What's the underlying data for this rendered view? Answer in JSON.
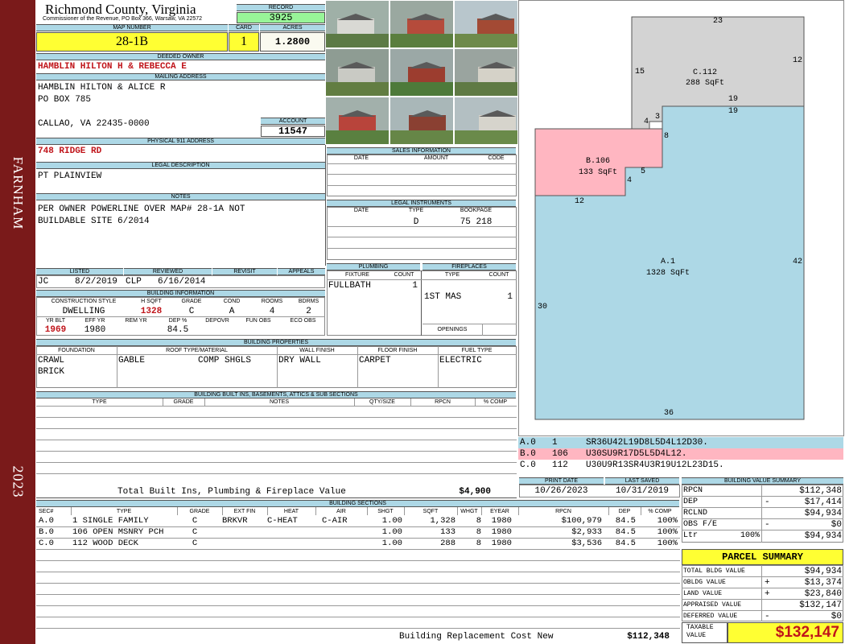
{
  "sidebar": {
    "district": "FARNHAM",
    "year": "2023"
  },
  "header": {
    "county": "Richmond County, Virginia",
    "commissioner": "Commissioner of the Revenue, PO Box 366, Warsaw, VA 22572",
    "record_label": "RECORD",
    "record": "3925",
    "map_number_label": "MAP NUMBER",
    "map_number": "28-1B",
    "card_label": "CARD",
    "card": "1",
    "acres_label": "ACRES",
    "acres": "1.2800"
  },
  "owner": {
    "deeded_owner_label": "DEEDED OWNER",
    "deeded_owner": "HAMBLIN HILTON H & REBECCA E",
    "mailing_label": "MAILING ADDRESS",
    "mailing_line1": "HAMBLIN HILTON & ALICE R",
    "mailing_line2": "PO BOX 785",
    "mailing_line3": "CALLAO, VA 22435-0000",
    "account_label": "ACCOUNT",
    "account": "11547",
    "physical_label": "PHYSICAL 911 ADDRESS",
    "physical": "748 RIDGE RD",
    "legal_label": "LEGAL DESCRIPTION",
    "legal": "PT PLAINVIEW",
    "notes_label": "NOTES",
    "notes_line1": "PER OWNER POWERLINE OVER MAP# 28-1A NOT",
    "notes_line2": "BUILDABLE SITE 6/2014"
  },
  "status": {
    "listed_label": "LISTED",
    "listed_by": "JC",
    "listed_date": "8/2/2019",
    "reviewed_label": "REVIEWED",
    "reviewed_by": "CLP",
    "reviewed_date": "6/16/2014",
    "revisit_label": "REVISIT",
    "appeals_label": "APPEALS"
  },
  "building_info": {
    "label": "BUILDING INFORMATION",
    "h_construction": "CONSTRUCTION STYLE",
    "h_hsqft": "H SQFT",
    "h_grade": "GRADE",
    "h_cond": "COND",
    "h_rooms": "ROOMS",
    "h_bdrms": "BDRMS",
    "construction": "DWELLING",
    "hsqft": "1328",
    "grade": "C",
    "cond": "A",
    "rooms": "4",
    "bdrms": "2",
    "h_yrblt": "YR BLT",
    "h_effyr": "EFF YR",
    "h_remyr": "REM YR",
    "h_dep": "DEP %",
    "h_depovr": "DEPOVR",
    "h_funobs": "FUN OBS",
    "h_ecoobs": "ECO OBS",
    "yrblt": "1969",
    "effyr": "1980",
    "dep": "84.5"
  },
  "sales": {
    "label": "SALES INFORMATION",
    "h_date": "DATE",
    "h_amount": "AMOUNT",
    "h_code": "CODE"
  },
  "legal_instruments": {
    "label": "LEGAL INSTRUMENTS",
    "h_date": "DATE",
    "h_type": "TYPE",
    "h_bookpage": "BOOKPAGE",
    "type": "D",
    "bookpage": "75 218"
  },
  "plumbing": {
    "label": "PLUMBING",
    "h_fixture": "FIXTURE",
    "h_count": "COUNT",
    "fixture": "FULLBATH",
    "count": "1"
  },
  "fireplaces": {
    "label": "FIREPLACES",
    "h_type": "TYPE",
    "h_count": "COUNT",
    "type": "1ST MAS",
    "count": "1",
    "openings_label": "OPENINGS"
  },
  "properties": {
    "label": "BUILDING PROPERTIES",
    "h_foundation": "FOUNDATION",
    "h_roof": "ROOF TYPE/MATERIAL",
    "h_wall": "WALL FINISH",
    "h_floor": "FLOOR FINISH",
    "h_fuel": "FUEL TYPE",
    "foundation1": "CRAWL",
    "foundation2": "BRICK",
    "roof_type": "GABLE",
    "roof_material": "COMP SHGLS",
    "wall": "DRY WALL",
    "floor": "CARPET",
    "fuel": "ELECTRIC"
  },
  "builtins": {
    "label": "BUILDING BUILT INS, BASEMENTS, ATTICS & SUB SECTIONS",
    "h_type": "TYPE",
    "h_grade": "GRADE",
    "h_notes": "NOTES",
    "h_qty": "QTY/SIZE",
    "h_rpcn": "RPCN",
    "h_comp": "% COMP",
    "total_label": "Total Built Ins, Plumbing & Fireplace Value",
    "total_value": "$4,900"
  },
  "print_info": {
    "print_label": "PRINT DATE",
    "print_date": "10/26/2023",
    "saved_label": "LAST SAVED",
    "saved_date": "10/31/2019"
  },
  "sections": {
    "label": "BUILDING SECTIONS",
    "headers": [
      "SEC#",
      "TYPE",
      "GRADE",
      "EXT FIN",
      "HEAT",
      "AIR",
      "SHGT",
      "SQFT",
      "WHGT",
      "EYEAR",
      "RPCN",
      "DEP",
      "% COMP"
    ],
    "rows": [
      {
        "sec": "A.0",
        "type": "1 SINGLE FAMILY",
        "grade": "C",
        "extfin": "BRKVR",
        "heat": "C-HEAT",
        "air": "C-AIR",
        "shgt": "1.00",
        "sqft": "1,328",
        "whgt": "8",
        "eyear": "1980",
        "rpcn": "$100,979",
        "dep": "84.5",
        "comp": "100%"
      },
      {
        "sec": "B.0",
        "type": "106 OPEN MSNRY PCH",
        "grade": "C",
        "extfin": "",
        "heat": "",
        "air": "",
        "shgt": "1.00",
        "sqft": "133",
        "whgt": "8",
        "eyear": "1980",
        "rpcn": "$2,933",
        "dep": "84.5",
        "comp": "100%"
      },
      {
        "sec": "C.0",
        "type": "112 WOOD DECK",
        "grade": "C",
        "extfin": "",
        "heat": "",
        "air": "",
        "shgt": "1.00",
        "sqft": "288",
        "whgt": "8",
        "eyear": "1980",
        "rpcn": "$3,536",
        "dep": "84.5",
        "comp": "100%"
      }
    ],
    "replacement_label": "Building Replacement Cost New",
    "replacement_value": "$112,348"
  },
  "sketch": {
    "a_label": "A.1",
    "a_area": "1328 SqFt",
    "b_label": "B.106",
    "b_area": "133 SqFt",
    "c_label": "C.112",
    "c_area": "288 SqFt",
    "dims": {
      "d23": "23",
      "d12": "12",
      "d15": "15",
      "d19a": "19",
      "d19b": "19",
      "d4a": "4",
      "d3": "3",
      "d8": "8",
      "d5": "5",
      "d4b": "4",
      "d12b": "12",
      "d42": "42",
      "d30": "30",
      "d36": "36"
    },
    "colors": {
      "a": "#add8e6",
      "b": "#ffb6c1",
      "c": "#d3d3d3"
    },
    "legend": [
      {
        "code": "A.0",
        "num": "1",
        "desc": "SR36U42L19D8L5D4L12D30."
      },
      {
        "code": "B.0",
        "num": "106",
        "desc": "U30SU9R17D5L5D4L12."
      },
      {
        "code": "C.0",
        "num": "112",
        "desc": "U30U9R13SR4U3R19U12L23D15."
      }
    ]
  },
  "value_summary": {
    "label": "BUILDING VALUE SUMMARY",
    "rpcn_label": "RPCN",
    "rpcn": "$112,348",
    "dep_label": "DEP",
    "dep_sign": "-",
    "dep": "$17,414",
    "rclnd_label": "RCLND",
    "rclnd": "$94,934",
    "obs_label": "OBS F/E",
    "obs_sign": "-",
    "obs": "$0",
    "ltr_label": "Ltr",
    "ltr_pct": "100%",
    "ltr": "$94,934"
  },
  "parcel": {
    "title": "PARCEL SUMMARY",
    "bldg_label": "TOTAL BLDG VALUE",
    "bldg": "$94,934",
    "obldg_label": "OBLDG VALUE",
    "obldg_sign": "+",
    "obldg": "$13,374",
    "land_label": "LAND VALUE",
    "land_sign": "+",
    "land": "$23,840",
    "appraised_label": "APPRAISED VALUE",
    "appraised": "$132,147",
    "deferred_label": "DEFERRED VALUE",
    "deferred_sign": "-",
    "deferred": "$0",
    "taxable_label1": "TAXABLE",
    "taxable_label2": "VALUE",
    "taxable": "$132,147"
  }
}
